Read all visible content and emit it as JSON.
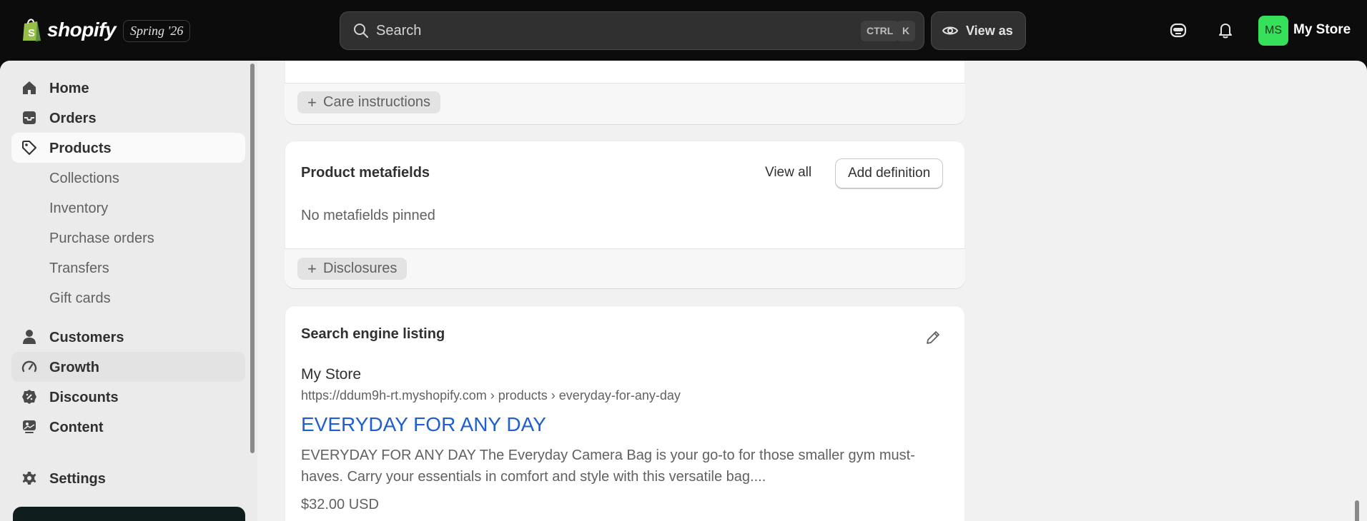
{
  "topbar": {
    "brand": "shopify",
    "edition": "Spring '26",
    "search_placeholder": "Search",
    "shortcut_ctrl": "CTRL",
    "shortcut_key": "K",
    "view_as": "View as",
    "avatar_initials": "MS",
    "store_name": "My Store"
  },
  "sidebar": {
    "items": [
      {
        "label": "Home",
        "icon": "home-icon"
      },
      {
        "label": "Orders",
        "icon": "inbox-icon"
      },
      {
        "label": "Products",
        "icon": "tag-icon"
      },
      {
        "label": "Collections"
      },
      {
        "label": "Inventory"
      },
      {
        "label": "Purchase orders"
      },
      {
        "label": "Transfers"
      },
      {
        "label": "Gift cards"
      },
      {
        "label": "Customers",
        "icon": "person-icon"
      },
      {
        "label": "Growth",
        "icon": "gauge-icon"
      },
      {
        "label": "Discounts",
        "icon": "discount-icon"
      },
      {
        "label": "Content",
        "icon": "content-icon"
      },
      {
        "label": "Settings",
        "icon": "gear-icon"
      }
    ]
  },
  "care_card": {
    "chip": "Care instructions"
  },
  "metafields_card": {
    "title": "Product metafields",
    "view_all": "View all",
    "add_definition": "Add definition",
    "empty_text": "No metafields pinned",
    "chip": "Disclosures"
  },
  "seo_card": {
    "title": "Search engine listing",
    "store": "My Store",
    "url": "https://ddum9h-rt.myshopify.com › products › everyday-for-any-day",
    "page_title": "EVERYDAY FOR ANY DAY",
    "description": "EVERYDAY FOR ANY DAY The Everyday Camera Bag is your go-to for those smaller gym must-haves. Carry your essentials in comfort and style with this versatile bag....",
    "price": "$32.00 USD"
  },
  "colors": {
    "accent_green": "#36e05a",
    "link_blue": "#1f5fd1",
    "topbar": "#0c0c0c"
  }
}
